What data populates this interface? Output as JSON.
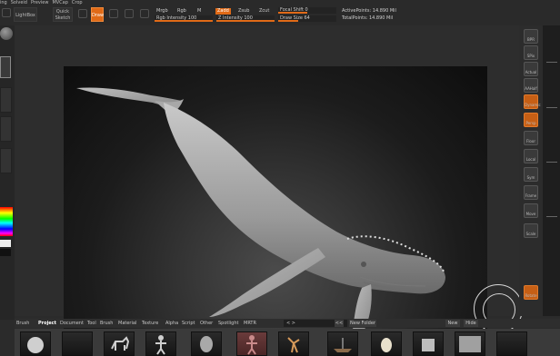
{
  "menu": [
    "ing",
    "Solveid",
    "Preview",
    "MVCap",
    "Crop"
  ],
  "toolbar": {
    "lightbox_label": "LightBox",
    "quick_sketch_line1": "Quick",
    "quick_sketch_line2": "Sketch",
    "draw_label": "Draw",
    "mrgb": "Mrgb",
    "rgb": "Rgb",
    "m": "M",
    "zadd": "Zadd",
    "zsub": "Zsub",
    "zcut": "Zcut",
    "focal_shift": "Focal Shift 0",
    "draw_size": "Draw Size 64",
    "rgb_intensity": "Rgb Intensity 100",
    "z_intensity": "Z Intensity 100",
    "focal_fill": 0.5,
    "draw_size_fill": 0.35,
    "rgb_fill": 1.0,
    "z_fill": 1.0,
    "active_points": "ActivePoints: 14.890 Mil",
    "total_points": "TotalPoints: 14.890 Mil"
  },
  "colors": {
    "accent": "#e06a17",
    "main": "#f0f0f0",
    "secondary": "#111111"
  },
  "right_shelf": [
    {
      "label": "BPR",
      "orange": false
    },
    {
      "label": "SPix",
      "orange": false
    },
    {
      "label": "Actual",
      "orange": false
    },
    {
      "label": "AAHalf",
      "orange": false
    },
    {
      "label": "Dynamic",
      "orange": true
    },
    {
      "label": "Persp",
      "orange": true
    },
    {
      "label": "Floor",
      "orange": false
    },
    {
      "label": "Local",
      "orange": false
    },
    {
      "label": "Sym",
      "orange": false
    },
    {
      "label": "Frame",
      "orange": false
    },
    {
      "label": "Move",
      "orange": false
    },
    {
      "label": "Scale",
      "orange": false
    },
    {
      "label": "Rotate",
      "orange": true
    }
  ],
  "lightbox": {
    "tabs": [
      "Brush",
      "Project",
      "Document",
      "Tool",
      "Brush",
      "Material",
      "Texture",
      "Alpha",
      "Script",
      "Other",
      "Spotlight",
      "MRTR"
    ],
    "selected_tab": "Project",
    "search_value": "< >",
    "nav_back": "<<",
    "new_folder": "New Folder",
    "new_label": "New",
    "hide_label": "Hide"
  },
  "thumbnails": [
    "sphere",
    "empty",
    "dog",
    "figure",
    "head",
    "figure-red",
    "dancer",
    "boat",
    "egg",
    "cube",
    "wall",
    "blank"
  ]
}
